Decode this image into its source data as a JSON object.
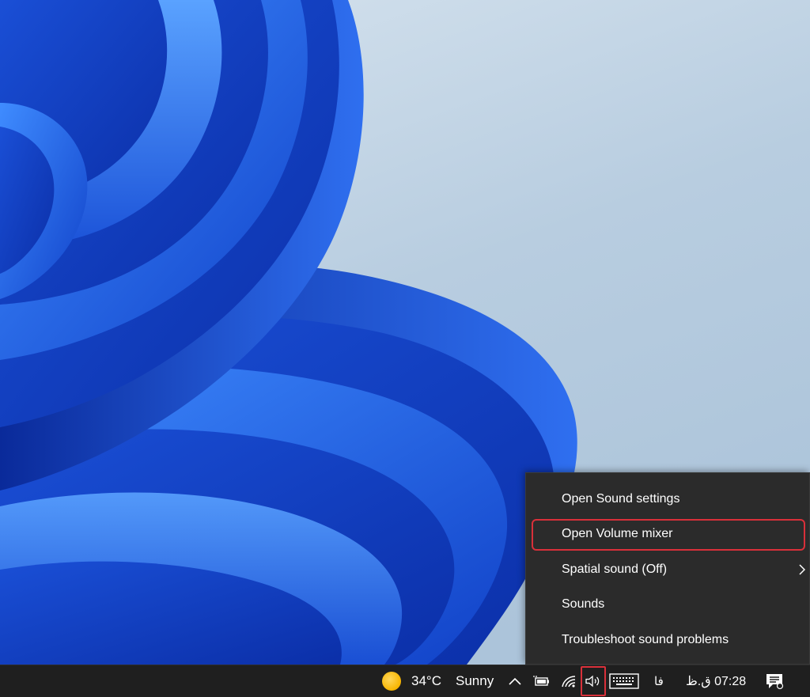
{
  "context_menu": {
    "items": [
      {
        "label": "Open Sound settings"
      },
      {
        "label": "Open Volume mixer"
      },
      {
        "label": "Spatial sound (Off)"
      },
      {
        "label": "Sounds"
      },
      {
        "label": "Troubleshoot sound problems"
      }
    ]
  },
  "taskbar": {
    "weather": {
      "icon": "sun-icon",
      "temperature": "34°C",
      "condition": "Sunny"
    },
    "tray": {
      "overflow_icon": "chevron-up-icon",
      "battery_icon": "battery-charging-icon",
      "wifi_icon": "wifi-icon",
      "volume_icon": "speaker-icon",
      "keyboard_icon": "touch-keyboard-icon",
      "input_language": "فا",
      "clock": "07:28 ق.ظ",
      "notifications_icon": "notification-center-icon"
    }
  },
  "colors": {
    "accent_highlight": "#d9303a",
    "menu_background": "#2b2b2b",
    "taskbar_background": "#1f1f1f"
  }
}
